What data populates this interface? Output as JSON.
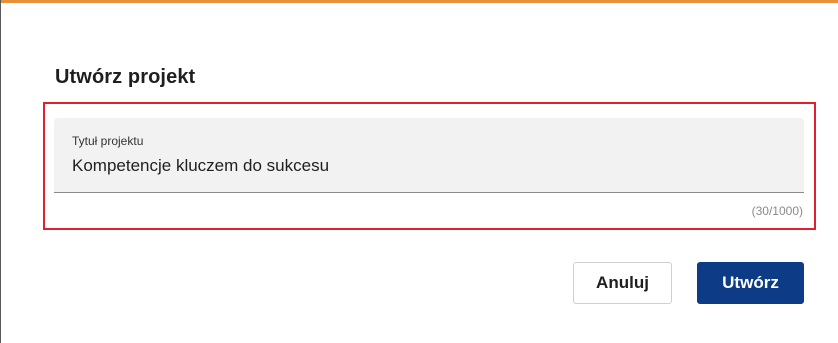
{
  "dialog": {
    "title": "Utwórz projekt",
    "accent_color": "#e8913a",
    "highlight_color": "#e0202e"
  },
  "field": {
    "label": "Tytuł projektu",
    "value": "Kompetencje kluczem do sukcesu",
    "counter": "(30/1000)"
  },
  "buttons": {
    "cancel_label": "Anuluj",
    "create_label": "Utwórz",
    "primary_color": "#0d3b86"
  }
}
